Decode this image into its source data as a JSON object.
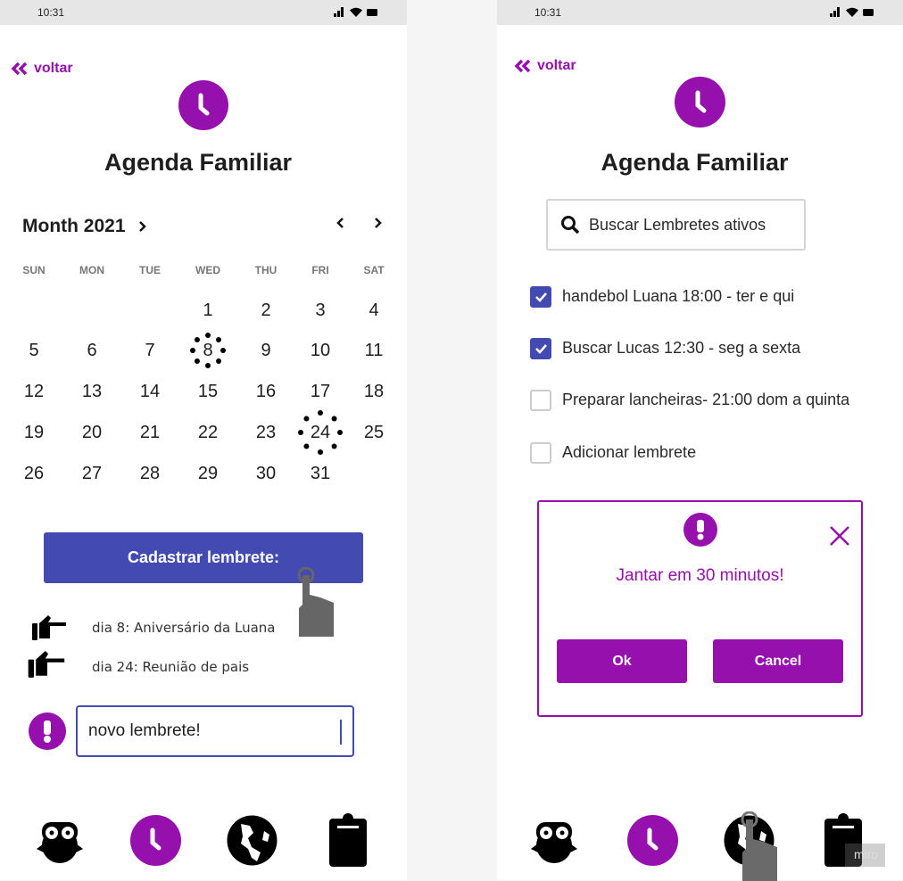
{
  "colors": {
    "accent": "#9510ac",
    "primary": "#434bb2",
    "status_bar": "#e6e6e6"
  },
  "status_bar": {
    "time": "10:31",
    "icons": [
      "signal-icon",
      "wifi-icon",
      "battery-icon"
    ]
  },
  "screen1": {
    "back_label": "voltar",
    "title": "Agenda Familiar",
    "calendar": {
      "month_label": "Month 2021",
      "weekdays": [
        "SUN",
        "MON",
        "TUE",
        "WED",
        "THU",
        "FRI",
        "SAT"
      ],
      "first_weekday": 3,
      "days_in_month": 31,
      "highlighted_days": [
        8,
        24
      ]
    },
    "register_button": "Cadastrar lembrete:",
    "reminders": [
      {
        "icon": "pointing-hand-icon",
        "text": "dia 8:  Aniversário da Luana"
      },
      {
        "icon": "pointing-hand-icon",
        "text": "dia 24: Reunião de pais"
      }
    ],
    "new_reminder_input": "novo lembrete!",
    "nav": [
      "owl-icon",
      "clock-icon",
      "globe-icon",
      "clipboard-icon"
    ],
    "active_nav": "clock-icon"
  },
  "screen2": {
    "back_label": "voltar",
    "title": "Agenda Familiar",
    "search_placeholder": "Buscar Lembretes ativos",
    "checklist": [
      {
        "label": "handebol Luana 18:00 - ter e qui",
        "checked": true
      },
      {
        "label": "Buscar Lucas 12:30 - seg a sexta",
        "checked": true
      },
      {
        "label": "Preparar lancheiras- 21:00 dom a quinta",
        "checked": false
      },
      {
        "label": "Adicionar lembrete",
        "checked": false
      }
    ],
    "dialog": {
      "message": "Jantar em 30 minutos!",
      "ok": "Ok",
      "cancel": "Cancel"
    },
    "nav": [
      "owl-icon",
      "clock-icon",
      "globe-icon",
      "clipboard-icon"
    ],
    "active_nav": "clock-icon"
  },
  "watermark": "miro"
}
